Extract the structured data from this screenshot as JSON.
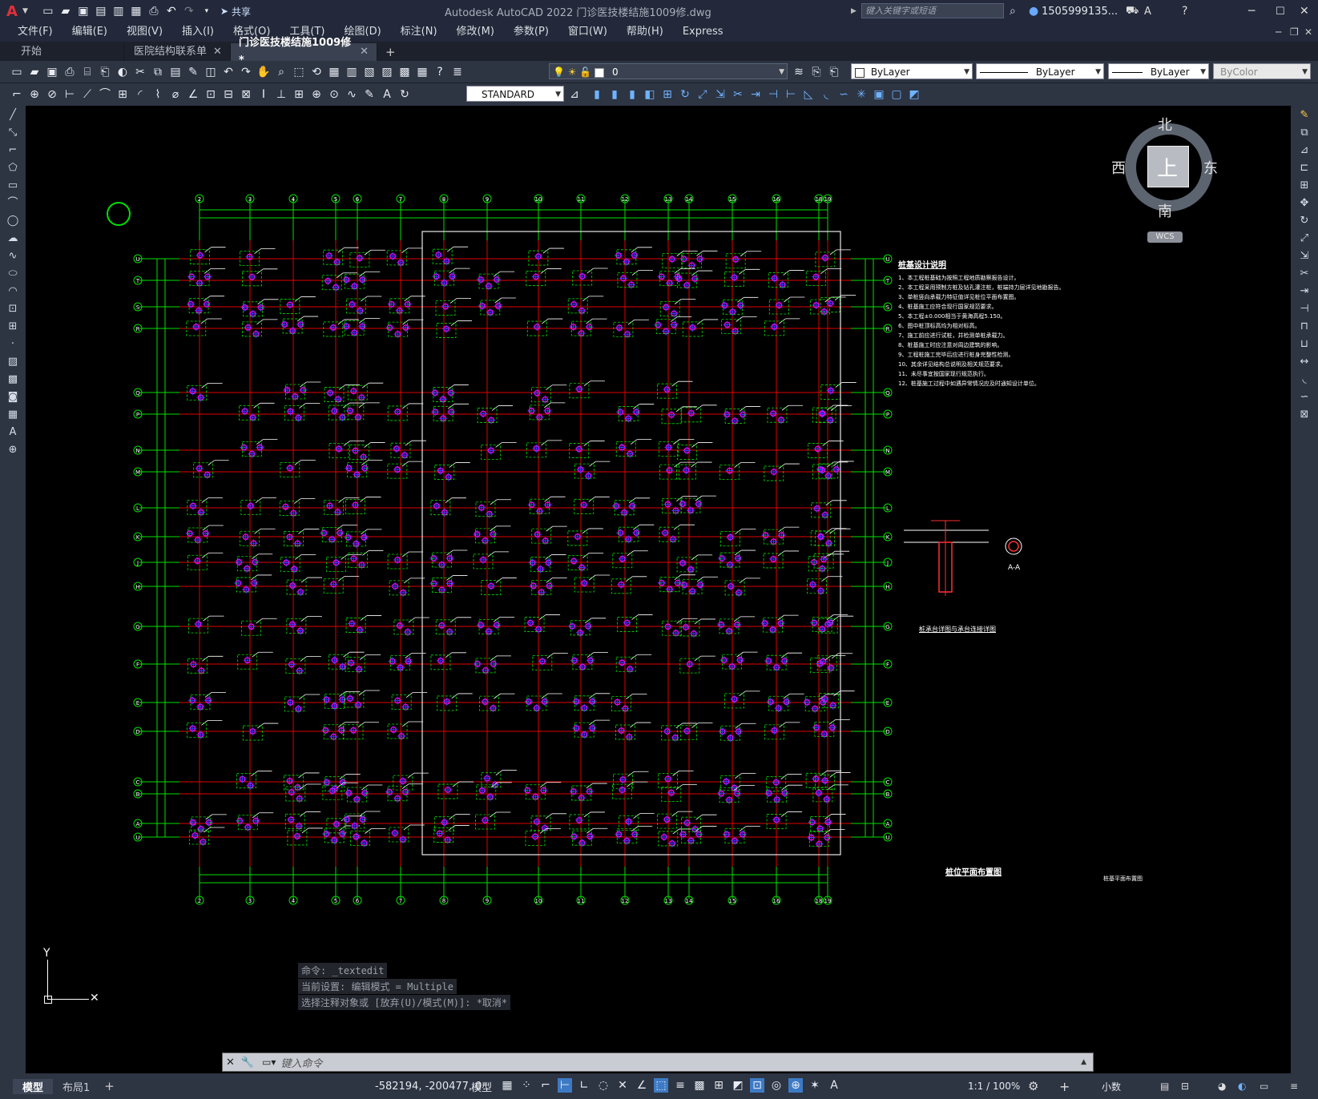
{
  "app": {
    "title": "Autodesk AutoCAD 2022    门诊医技楼结施1009修.dwg",
    "share_label": "共享",
    "search_placeholder": "键入关键字或短语",
    "user": "1505999135...",
    "logo": "A"
  },
  "menu": [
    "文件(F)",
    "编辑(E)",
    "视图(V)",
    "插入(I)",
    "格式(O)",
    "工具(T)",
    "绘图(D)",
    "标注(N)",
    "修改(M)",
    "参数(P)",
    "窗口(W)",
    "帮助(H)",
    "Express"
  ],
  "tabs": [
    {
      "label": "开始"
    },
    {
      "label": "医院结构联系单"
    },
    {
      "label": "门诊医技楼结施1009修*"
    }
  ],
  "toolbar": {
    "layer_value": "0",
    "color_value": "ByLayer",
    "linetype_value": "ByLayer",
    "lineweight_value": "ByLayer",
    "plotstyle_value": "ByColor",
    "textstyle_value": "STANDARD"
  },
  "viewcube": {
    "north": "北",
    "south": "南",
    "east": "东",
    "west": "西",
    "top": "上",
    "wcs": "WCS"
  },
  "drawing": {
    "col_labels": [
      "2",
      "3",
      "4",
      "5",
      "6",
      "7",
      "8",
      "9",
      "10",
      "11",
      "12",
      "13",
      "14",
      "15",
      "16",
      "18",
      "19"
    ],
    "row_labels": [
      "U",
      "T",
      "S",
      "R",
      "Q",
      "P",
      "N",
      "M",
      "L",
      "K",
      "J",
      "H",
      "G",
      "F",
      "E",
      "D",
      "C",
      "B",
      "A"
    ],
    "notes_title": "桩基设计说明",
    "notes": [
      "1、本工程桩基础为按照工程地质勘察报告设计。",
      "2、本工程采用预制方桩及钻孔灌注桩，桩端持力层详见地勘报告。",
      "3、单桩竖向承载力特征值详见桩位平面布置图。",
      "4、桩基施工应符合现行国家规范要求。",
      "5、本工程±0.000相当于黄海高程5.150。",
      "6、图中桩顶标高均为相对标高。",
      "7、施工前应进行试桩，并检测单桩承载力。",
      "8、桩基施工时应注意对周边建筑的影响。",
      "9、工程桩施工完毕后应进行桩身完整性检测。",
      "10、其余详见结构总说明及相关规范要求。",
      "11、未尽事宜按国家现行规范执行。",
      "12、桩基施工过程中如遇异常情况应及时通知设计单位。"
    ],
    "detail_title": "桩承台详图与承台连接详图",
    "section_label": "A-A",
    "plan_title": "桩位平面布置图",
    "small_title": "桩基平面布置图"
  },
  "command": {
    "history": [
      "命令: _textedit",
      "当前设置: 编辑模式 = Multiple",
      "选择注释对象或 [放弃(U)/模式(M)]: *取消*"
    ],
    "placeholder": "键入命令"
  },
  "status": {
    "tabs": [
      "模型",
      "布局1"
    ],
    "coords": "-582194, -200477, 0",
    "model_label": "模型",
    "scale": "1:1 / 100%",
    "units": "小数"
  },
  "colors": {
    "grid_red": "#e00000",
    "grid_green": "#00e000",
    "pile_magenta": "#ff00ff",
    "pile_blue": "#3a3aff",
    "frame_white": "#e8e8e8"
  }
}
